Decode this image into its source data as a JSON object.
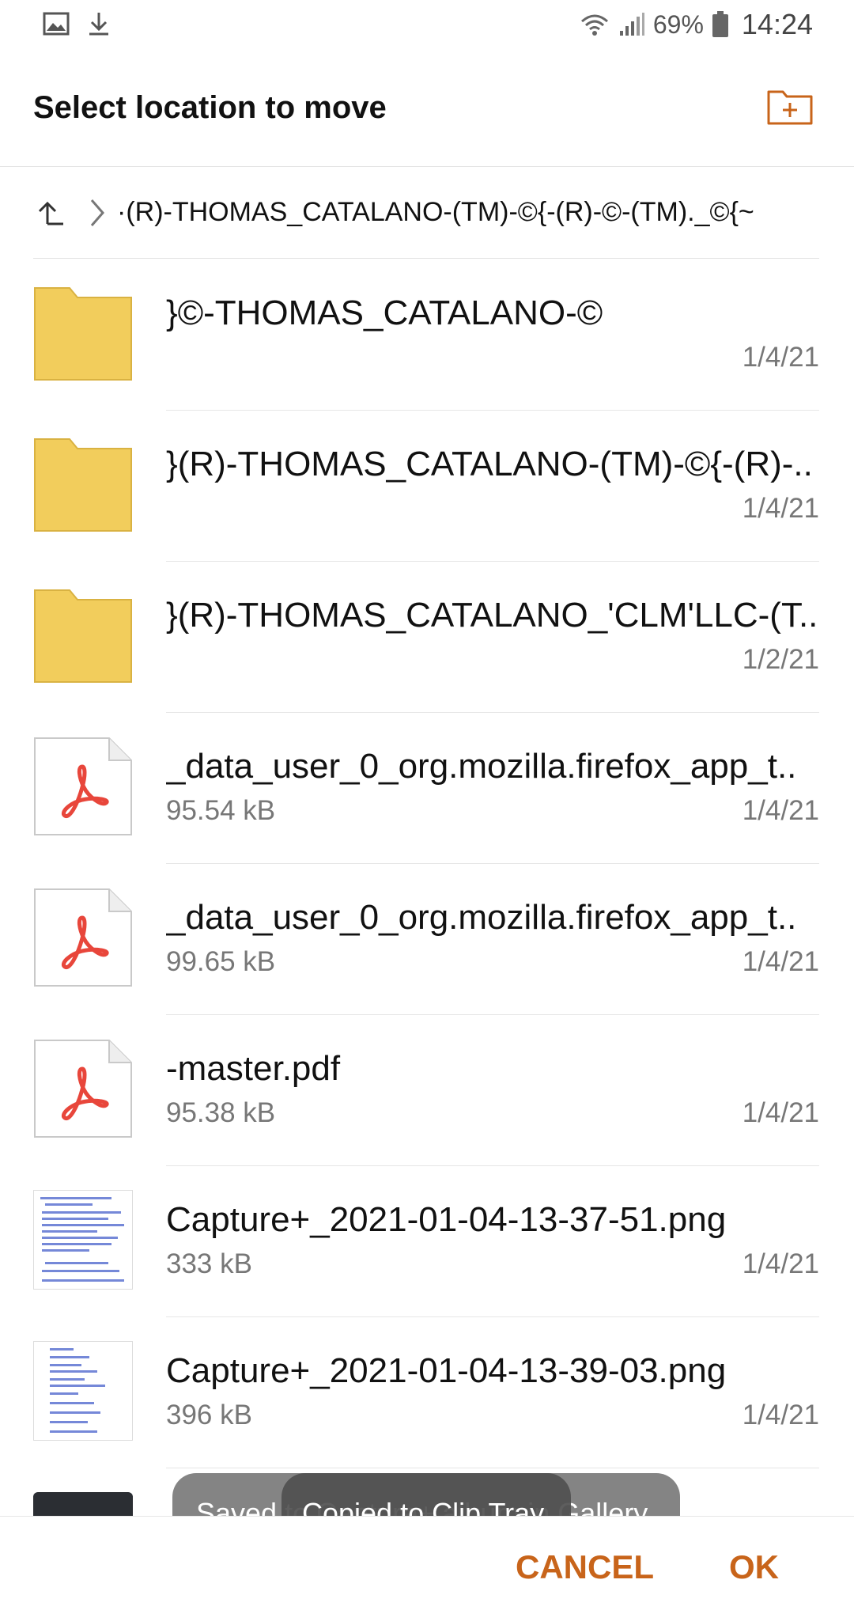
{
  "status_bar": {
    "icons_left": [
      "gallery-icon",
      "download-icon"
    ],
    "battery_percent": "69%",
    "time": "14:24"
  },
  "header": {
    "title": "Select location to move",
    "new_folder_icon": "new-folder-icon"
  },
  "path": {
    "up_icon": "up-icon",
    "text": "·(R)-THOMAS_CATALANO-(TM)-©{-(R)-©-(TM)._©{~"
  },
  "items": [
    {
      "type": "folder",
      "name": "}©-THOMAS_CATALANO-©",
      "size": "",
      "date": "1/4/21"
    },
    {
      "type": "folder",
      "name": "}(R)-THOMAS_CATALANO-(TM)-©{-(R)-..",
      "size": "",
      "date": "1/4/21"
    },
    {
      "type": "folder",
      "name": "}(R)-THOMAS_CATALANO_'CLM'LLC-(T..",
      "size": "",
      "date": "1/2/21"
    },
    {
      "type": "pdf",
      "name": "_data_user_0_org.mozilla.firefox_app_t..",
      "size": "95.54 kB",
      "date": "1/4/21"
    },
    {
      "type": "pdf",
      "name": "_data_user_0_org.mozilla.firefox_app_t..",
      "size": "99.65 kB",
      "date": "1/4/21"
    },
    {
      "type": "pdf",
      "name": "-master.pdf",
      "size": "95.38 kB",
      "date": "1/4/21"
    },
    {
      "type": "image",
      "name": "Capture+_2021-01-04-13-37-51.png",
      "size": "333 kB",
      "date": "1/4/21"
    },
    {
      "type": "image",
      "name": "Capture+_2021-01-04-13-39-03.png",
      "size": "396 kB",
      "date": "1/4/21"
    }
  ],
  "toasts": {
    "back": "Saved to Capture+ album in Gallery",
    "front": "Copied to Clip Tray"
  },
  "actions": {
    "cancel": "CANCEL",
    "ok": "OK"
  },
  "colors": {
    "accent": "#c8641a",
    "folder": "#f2cd5c",
    "pdf_red": "#e8463b"
  }
}
